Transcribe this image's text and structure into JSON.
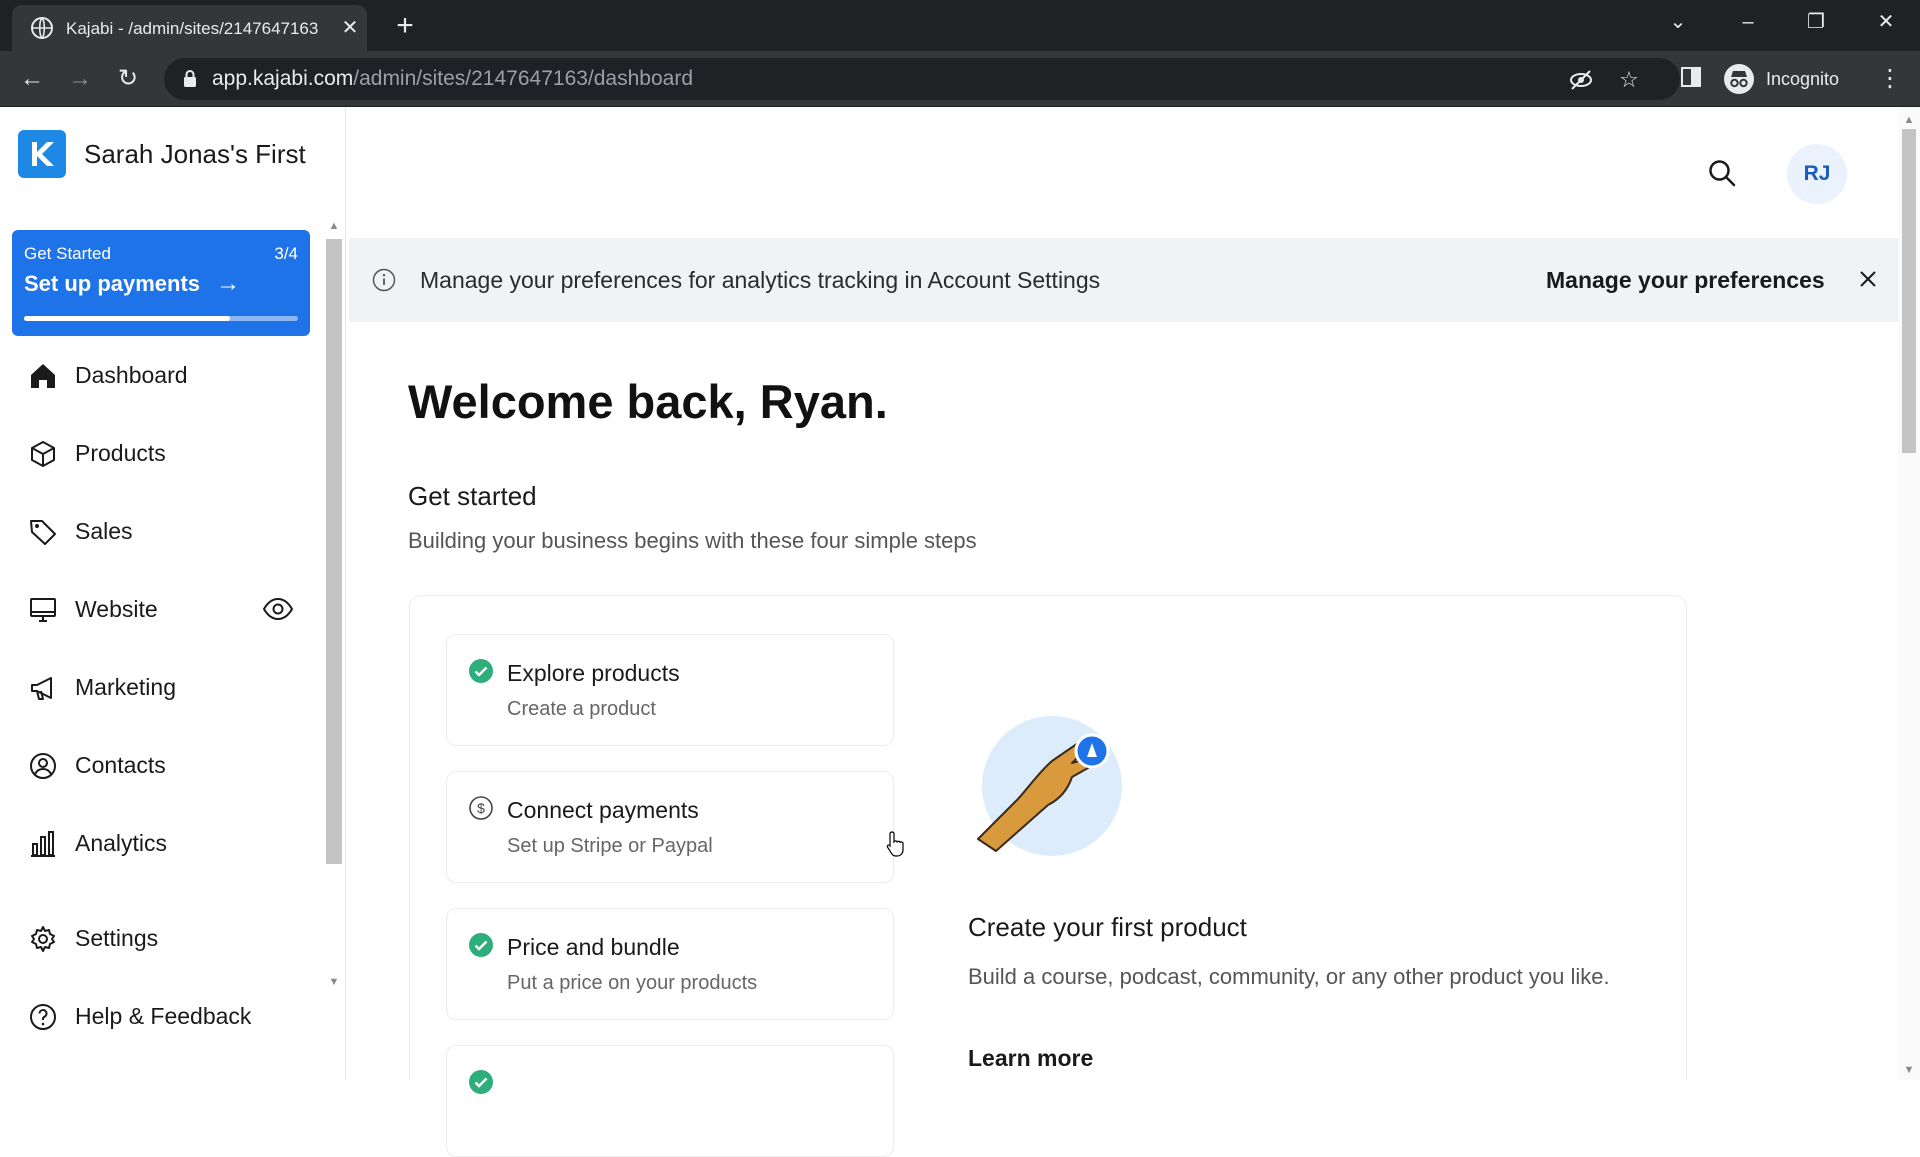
{
  "browser": {
    "tab_title": "Kajabi - /admin/sites/2147647163",
    "tab_close": "✕",
    "new_tab": "+",
    "url_host": "app.kajabi.com",
    "url_path": "/admin/sites/2147647163/dashboard",
    "profile_label": "Incognito"
  },
  "sidebar": {
    "brand_name": "Sarah Jonas's First",
    "get_started": {
      "label": "Get Started",
      "count": "3/4",
      "title": "Set up payments",
      "arrow": "→",
      "progress": 0.75
    },
    "items": [
      {
        "label": "Dashboard",
        "icon": "home-icon"
      },
      {
        "label": "Products",
        "icon": "box-icon"
      },
      {
        "label": "Sales",
        "icon": "tag-icon"
      },
      {
        "label": "Website",
        "icon": "monitor-icon",
        "trailing_icon": "eye-icon"
      },
      {
        "label": "Marketing",
        "icon": "megaphone-icon"
      },
      {
        "label": "Contacts",
        "icon": "user-circle-icon"
      },
      {
        "label": "Analytics",
        "icon": "bar-chart-icon"
      },
      {
        "label": "Settings",
        "icon": "gear-icon"
      },
      {
        "label": "Help & Feedback",
        "icon": "help-circle-icon"
      }
    ]
  },
  "header": {
    "avatar_initials": "RJ"
  },
  "banner": {
    "text": "Manage your preferences for analytics tracking in Account Settings",
    "link": "Manage your preferences"
  },
  "main": {
    "welcome": "Welcome back, Ryan.",
    "get_started_heading": "Get started",
    "get_started_subtitle": "Building your business begins with these four simple steps",
    "steps": [
      {
        "title": "Explore products",
        "subtitle": "Create a product",
        "status": "complete"
      },
      {
        "title": "Connect payments",
        "subtitle": "Set up Stripe or Paypal",
        "status": "pending"
      },
      {
        "title": "Price and bundle",
        "subtitle": "Put a price on your products",
        "status": "complete"
      },
      {
        "title": "",
        "subtitle": "",
        "status": "complete"
      }
    ],
    "detail": {
      "title": "Create your first product",
      "description": "Build a course, podcast, community, or any other product you like.",
      "link": "Learn more"
    }
  },
  "colors": {
    "brand_blue": "#1e73e8",
    "check_green": "#2eae7a",
    "banner_bg": "#f1f2f4",
    "browser_dark": "#202124"
  }
}
